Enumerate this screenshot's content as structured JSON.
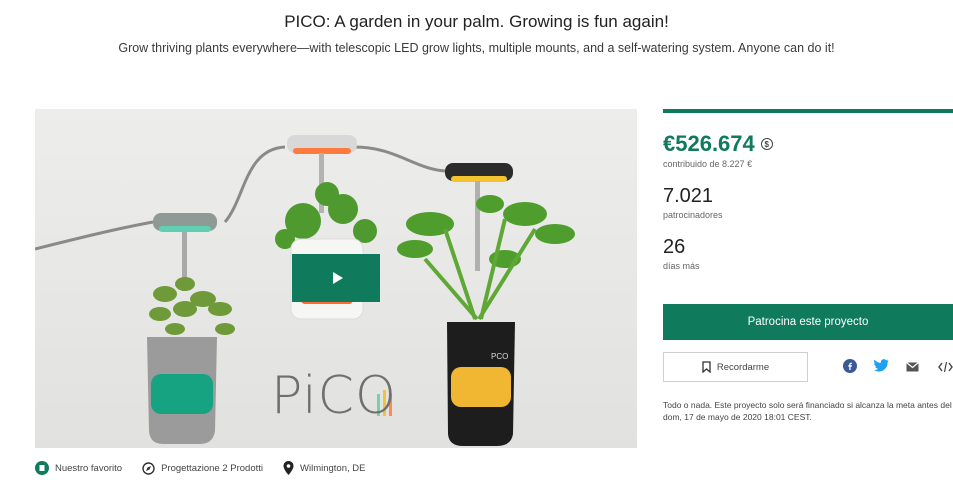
{
  "header": {
    "title": "PICO: A garden in your palm. Growing is fun again!",
    "subtitle": "Grow thriving plants everywhere—with telescopic LED grow lights, multiple mounts, and a self-watering system. Anyone can do it!"
  },
  "media": {
    "logo_text": "PiCO",
    "pot_label": "PCO",
    "play_icon": "play-icon"
  },
  "meta": {
    "items": [
      {
        "icon": "kickstarter-badge-icon",
        "label": "Nuestro favorito"
      },
      {
        "icon": "compass-icon",
        "label": "Progettazione 2 Prodotti"
      },
      {
        "icon": "location-pin-icon",
        "label": "Wilmington, DE"
      }
    ]
  },
  "stats": {
    "pledged": "€526.674",
    "goal": "contribuido de 8.227 €",
    "backers": "7.021",
    "backers_label": "patrocinadores",
    "days": "26",
    "days_label": "días más"
  },
  "actions": {
    "back_label": "Patrocina este proyecto",
    "remind_label": "Recordarme",
    "share_icons": [
      "facebook-icon",
      "twitter-icon",
      "email-icon",
      "embed-icon"
    ]
  },
  "note": "Todo o nada. Este proyecto solo será financiado si alcanza la meta antes del dom, 17 de mayo de 2020 18:01 CEST.",
  "colors": {
    "accent": "#0f7a5c",
    "facebook": "#3b5998",
    "twitter": "#1da1f2"
  }
}
